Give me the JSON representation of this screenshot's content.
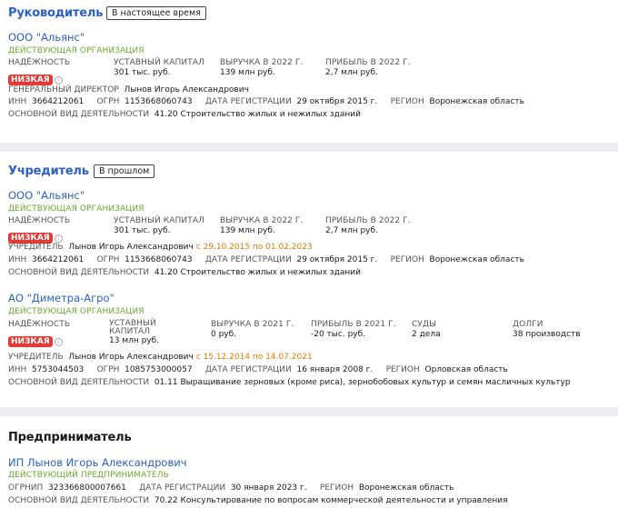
{
  "manager": {
    "title": "Руководитель",
    "badge": "В настоящее время",
    "company": {
      "name": "ООО \"Альянс\"",
      "status": "ДЕЙСТВУЮЩАЯ ОРГАНИЗАЦИЯ",
      "reliability_label": "НАДЁЖНОСТЬ",
      "reliability_value": "НИЗКАЯ",
      "capital_label": "УСТАВНЫЙ КАПИТАЛ",
      "capital_value": "301 тыс. руб.",
      "revenue_label": "ВЫРУЧКА В 2022 Г.",
      "revenue_value": "139 млн руб.",
      "profit_label": "ПРИБЫЛЬ В 2022 Г.",
      "profit_value": "2,7 млн руб.",
      "director_label": "ГЕНЕРАЛЬНЫЙ ДИРЕКТОР",
      "director_value": "Лынов Игорь Александрович",
      "inn_label": "ИНН",
      "inn_value": "3664212061",
      "ogrn_label": "ОГРН",
      "ogrn_value": "1153668060743",
      "reg_label": "ДАТА РЕГИСТРАЦИИ",
      "reg_value": "29 октября 2015 г.",
      "region_label": "РЕГИОН",
      "region_value": "Воронежская область",
      "activity_label": "ОСНОВНОЙ ВИД ДЕЯТЕЛЬНОСТИ",
      "activity_value": "41.20 Строительство жилых и нежилых зданий"
    }
  },
  "founder": {
    "title": "Учредитель",
    "badge": "В прошлом",
    "companies": [
      {
        "name": "ООО \"Альянс\"",
        "status": "ДЕЙСТВУЮЩАЯ ОРГАНИЗАЦИЯ",
        "reliability_label": "НАДЁЖНОСТЬ",
        "reliability_value": "НИЗКАЯ",
        "capital_label": "УСТАВНЫЙ КАПИТАЛ",
        "capital_value": "301 тыс. руб.",
        "revenue_label": "ВЫРУЧКА В 2022 Г.",
        "revenue_value": "139 млн руб.",
        "profit_label": "ПРИБЫЛЬ В 2022 Г.",
        "profit_value": "2,7 млн руб.",
        "founder_label": "УЧРЕДИТЕЛЬ",
        "founder_value": "Лынов Игорь Александрович",
        "founder_period": "с 29.10.2015 по 01.02.2023",
        "inn_label": "ИНН",
        "inn_value": "3664212061",
        "ogrn_label": "ОГРН",
        "ogrn_value": "1153668060743",
        "reg_label": "ДАТА РЕГИСТРАЦИИ",
        "reg_value": "29 октября 2015 г.",
        "region_label": "РЕГИОН",
        "region_value": "Воронежская область",
        "activity_label": "ОСНОВНОЙ ВИД ДЕЯТЕЛЬНОСТИ",
        "activity_value": "41.20 Строительство жилых и нежилых зданий"
      },
      {
        "name": "АО \"Диметра-Агро\"",
        "status": "ДЕЙСТВУЮЩАЯ ОРГАНИЗАЦИЯ",
        "reliability_label": "НАДЁЖНОСТЬ",
        "reliability_value": "НИЗКАЯ",
        "capital_label": "УСТАВНЫЙ КАПИТАЛ",
        "capital_value": "13 млн руб.",
        "revenue_label": "ВЫРУЧКА В 2021 Г.",
        "revenue_value": "0 руб.",
        "profit_label": "ПРИБЫЛЬ В 2021 Г.",
        "profit_value": "-20 тыс. руб.",
        "courts_label": "СУДЫ",
        "courts_value": "2 дела",
        "debts_label": "ДОЛГИ",
        "debts_value": "38 производств",
        "founder_label": "УЧРЕДИТЕЛЬ",
        "founder_value": "Лынов Игорь Александрович",
        "founder_period": "с 15.12.2014 по 14.07.2021",
        "inn_label": "ИНН",
        "inn_value": "5753044503",
        "ogrn_label": "ОГРН",
        "ogrn_value": "1085753000057",
        "reg_label": "ДАТА РЕГИСТРАЦИИ",
        "reg_value": "16 января 2008 г.",
        "region_label": "РЕГИОН",
        "region_value": "Орловская область",
        "activity_label": "ОСНОВНОЙ ВИД ДЕЯТЕЛЬНОСТИ",
        "activity_value": "01.11 Выращивание зерновых (кроме риса), зернобобовых культур и семян масличных культур"
      }
    ]
  },
  "entrepreneur": {
    "title": "Предприниматель",
    "name": "ИП Лынов Игорь Александрович",
    "status": "ДЕЙСТВУЮЩИЙ ПРЕДПРИНИМАТЕЛЬ",
    "ogrnip_label": "ОГРНИП",
    "ogrnip_value": "323366800007661",
    "reg_label": "ДАТА РЕГИСТРАЦИИ",
    "reg_value": "30 января 2023 г.",
    "region_label": "РЕГИОН",
    "region_value": "Воронежская область",
    "activity_label": "ОСНОВНОЙ ВИД ДЕЯТЕЛЬНОСТИ",
    "activity_value": "70.22 Консультирование по вопросам коммерческой деятельности и управления"
  },
  "colors": {
    "link": "#2a62c4",
    "status_active": "#6aab2e",
    "reliability_low": "#e53935",
    "period": "#e07b00"
  },
  "icons": [
    "info-icon"
  ]
}
